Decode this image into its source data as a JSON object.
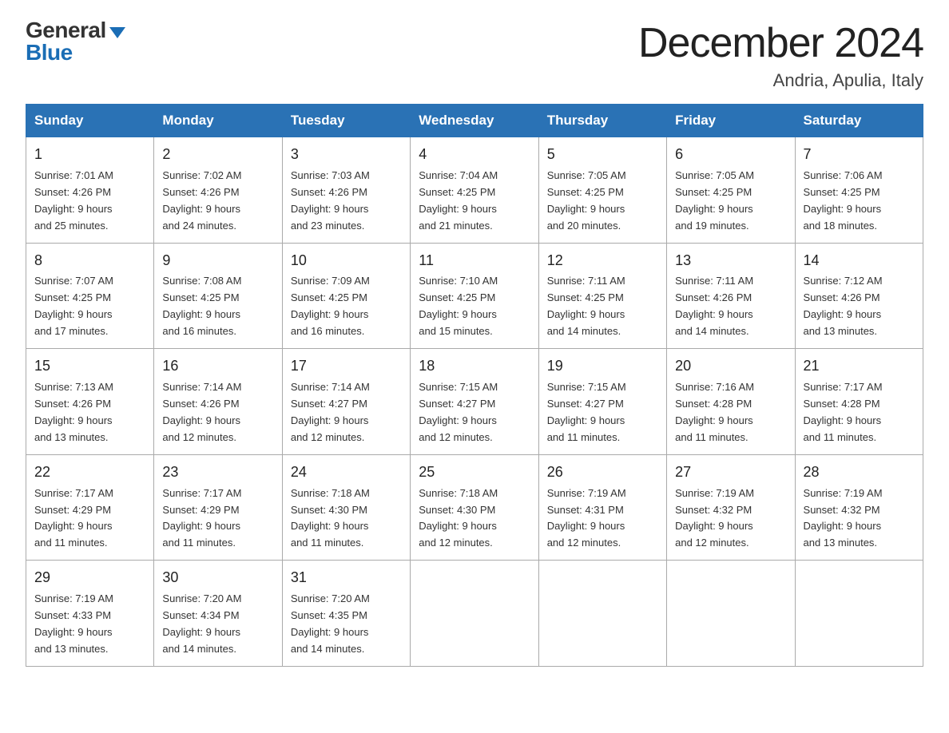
{
  "logo": {
    "general": "General",
    "blue": "Blue"
  },
  "title": "December 2024",
  "subtitle": "Andria, Apulia, Italy",
  "days_of_week": [
    "Sunday",
    "Monday",
    "Tuesday",
    "Wednesday",
    "Thursday",
    "Friday",
    "Saturday"
  ],
  "weeks": [
    [
      {
        "day": "1",
        "sunrise": "7:01 AM",
        "sunset": "4:26 PM",
        "daylight": "9 hours and 25 minutes."
      },
      {
        "day": "2",
        "sunrise": "7:02 AM",
        "sunset": "4:26 PM",
        "daylight": "9 hours and 24 minutes."
      },
      {
        "day": "3",
        "sunrise": "7:03 AM",
        "sunset": "4:26 PM",
        "daylight": "9 hours and 23 minutes."
      },
      {
        "day": "4",
        "sunrise": "7:04 AM",
        "sunset": "4:25 PM",
        "daylight": "9 hours and 21 minutes."
      },
      {
        "day": "5",
        "sunrise": "7:05 AM",
        "sunset": "4:25 PM",
        "daylight": "9 hours and 20 minutes."
      },
      {
        "day": "6",
        "sunrise": "7:05 AM",
        "sunset": "4:25 PM",
        "daylight": "9 hours and 19 minutes."
      },
      {
        "day": "7",
        "sunrise": "7:06 AM",
        "sunset": "4:25 PM",
        "daylight": "9 hours and 18 minutes."
      }
    ],
    [
      {
        "day": "8",
        "sunrise": "7:07 AM",
        "sunset": "4:25 PM",
        "daylight": "9 hours and 17 minutes."
      },
      {
        "day": "9",
        "sunrise": "7:08 AM",
        "sunset": "4:25 PM",
        "daylight": "9 hours and 16 minutes."
      },
      {
        "day": "10",
        "sunrise": "7:09 AM",
        "sunset": "4:25 PM",
        "daylight": "9 hours and 16 minutes."
      },
      {
        "day": "11",
        "sunrise": "7:10 AM",
        "sunset": "4:25 PM",
        "daylight": "9 hours and 15 minutes."
      },
      {
        "day": "12",
        "sunrise": "7:11 AM",
        "sunset": "4:25 PM",
        "daylight": "9 hours and 14 minutes."
      },
      {
        "day": "13",
        "sunrise": "7:11 AM",
        "sunset": "4:26 PM",
        "daylight": "9 hours and 14 minutes."
      },
      {
        "day": "14",
        "sunrise": "7:12 AM",
        "sunset": "4:26 PM",
        "daylight": "9 hours and 13 minutes."
      }
    ],
    [
      {
        "day": "15",
        "sunrise": "7:13 AM",
        "sunset": "4:26 PM",
        "daylight": "9 hours and 13 minutes."
      },
      {
        "day": "16",
        "sunrise": "7:14 AM",
        "sunset": "4:26 PM",
        "daylight": "9 hours and 12 minutes."
      },
      {
        "day": "17",
        "sunrise": "7:14 AM",
        "sunset": "4:27 PM",
        "daylight": "9 hours and 12 minutes."
      },
      {
        "day": "18",
        "sunrise": "7:15 AM",
        "sunset": "4:27 PM",
        "daylight": "9 hours and 12 minutes."
      },
      {
        "day": "19",
        "sunrise": "7:15 AM",
        "sunset": "4:27 PM",
        "daylight": "9 hours and 11 minutes."
      },
      {
        "day": "20",
        "sunrise": "7:16 AM",
        "sunset": "4:28 PM",
        "daylight": "9 hours and 11 minutes."
      },
      {
        "day": "21",
        "sunrise": "7:17 AM",
        "sunset": "4:28 PM",
        "daylight": "9 hours and 11 minutes."
      }
    ],
    [
      {
        "day": "22",
        "sunrise": "7:17 AM",
        "sunset": "4:29 PM",
        "daylight": "9 hours and 11 minutes."
      },
      {
        "day": "23",
        "sunrise": "7:17 AM",
        "sunset": "4:29 PM",
        "daylight": "9 hours and 11 minutes."
      },
      {
        "day": "24",
        "sunrise": "7:18 AM",
        "sunset": "4:30 PM",
        "daylight": "9 hours and 11 minutes."
      },
      {
        "day": "25",
        "sunrise": "7:18 AM",
        "sunset": "4:30 PM",
        "daylight": "9 hours and 12 minutes."
      },
      {
        "day": "26",
        "sunrise": "7:19 AM",
        "sunset": "4:31 PM",
        "daylight": "9 hours and 12 minutes."
      },
      {
        "day": "27",
        "sunrise": "7:19 AM",
        "sunset": "4:32 PM",
        "daylight": "9 hours and 12 minutes."
      },
      {
        "day": "28",
        "sunrise": "7:19 AM",
        "sunset": "4:32 PM",
        "daylight": "9 hours and 13 minutes."
      }
    ],
    [
      {
        "day": "29",
        "sunrise": "7:19 AM",
        "sunset": "4:33 PM",
        "daylight": "9 hours and 13 minutes."
      },
      {
        "day": "30",
        "sunrise": "7:20 AM",
        "sunset": "4:34 PM",
        "daylight": "9 hours and 14 minutes."
      },
      {
        "day": "31",
        "sunrise": "7:20 AM",
        "sunset": "4:35 PM",
        "daylight": "9 hours and 14 minutes."
      },
      null,
      null,
      null,
      null
    ]
  ],
  "labels": {
    "sunrise": "Sunrise:",
    "sunset": "Sunset:",
    "daylight": "Daylight:"
  }
}
